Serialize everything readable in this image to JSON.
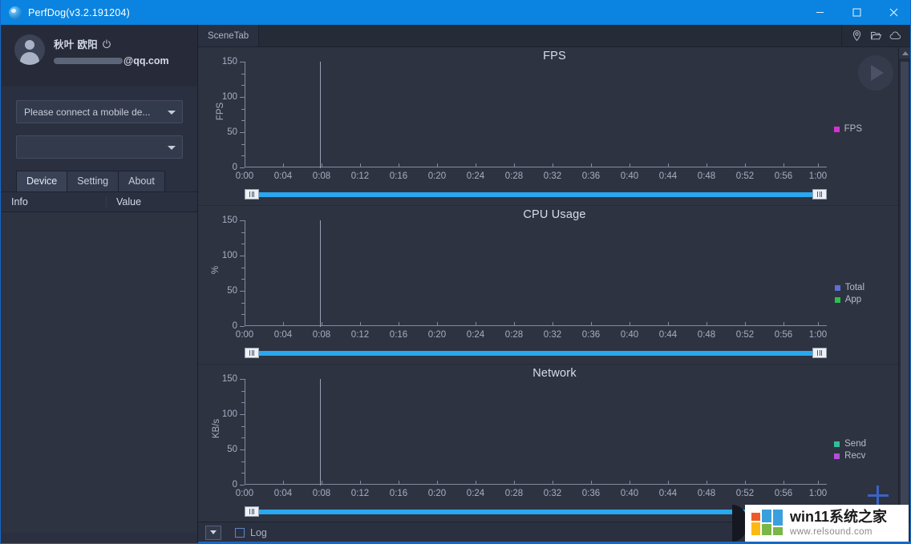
{
  "window": {
    "title": "PerfDog(v3.2.191204)",
    "logo_icon": "perfdog-logo-icon",
    "minimize_label": "Minimize",
    "maximize_label": "Maximize",
    "close_label": "Close"
  },
  "sidebar": {
    "user": {
      "name": "秋叶 欧阳",
      "power_icon": "power-icon",
      "email": "@qq.com",
      "avatar_icon": "user-avatar-icon"
    },
    "device_select": {
      "value": "Please connect a mobile de...",
      "caret_icon": "chevron-down-icon"
    },
    "app_select": {
      "value": "",
      "placeholder": "",
      "caret_icon": "chevron-down-icon"
    },
    "tabs": [
      {
        "label": "Device",
        "active": true
      },
      {
        "label": "Setting",
        "active": false
      },
      {
        "label": "About",
        "active": false
      }
    ],
    "table": {
      "columns": [
        "Info",
        "Value"
      ],
      "rows": []
    }
  },
  "scenebar": {
    "tab_label": "SceneTab",
    "icons": [
      {
        "name": "location-pin-icon",
        "label": "Location"
      },
      {
        "name": "open-folder-icon",
        "label": "Open folder"
      },
      {
        "name": "cloud-icon",
        "label": "Cloud"
      }
    ]
  },
  "controls": {
    "play_label": "Start",
    "play_icon": "play-icon",
    "add_label": "Add",
    "add_icon": "plus-icon",
    "collapse_icon": "chevron-down-icon",
    "log_label": "Log",
    "log_checked": false,
    "slider_handle_icon": "slider-grip-icon"
  },
  "axis": {
    "y_ticks": [
      "150",
      "100",
      "50",
      "0"
    ],
    "x_ticks": [
      "0:00",
      "0:04",
      "0:08",
      "0:12",
      "0:16",
      "0:20",
      "0:24",
      "0:28",
      "0:32",
      "0:36",
      "0:40",
      "0:44",
      "0:48",
      "0:52",
      "0:56",
      "1:00"
    ]
  },
  "chart_data": [
    {
      "type": "line",
      "title": "FPS",
      "xlabel": "",
      "ylabel": "FPS",
      "ylim": [
        0,
        150
      ],
      "y_ticks": [
        0,
        50,
        100,
        150
      ],
      "x_ticks": [
        "0:00",
        "0:04",
        "0:08",
        "0:12",
        "0:16",
        "0:20",
        "0:24",
        "0:28",
        "0:32",
        "0:36",
        "0:40",
        "0:44",
        "0:48",
        "0:52",
        "0:56",
        "1:00"
      ],
      "grid": false,
      "legend_position": "right",
      "cursor_time": "0:07",
      "series": [
        {
          "name": "FPS",
          "color": "#d62fd6",
          "values": []
        }
      ]
    },
    {
      "type": "line",
      "title": "CPU Usage",
      "xlabel": "",
      "ylabel": "%",
      "ylim": [
        0,
        150
      ],
      "y_ticks": [
        0,
        50,
        100,
        150
      ],
      "x_ticks": [
        "0:00",
        "0:04",
        "0:08",
        "0:12",
        "0:16",
        "0:20",
        "0:24",
        "0:28",
        "0:32",
        "0:36",
        "0:40",
        "0:44",
        "0:48",
        "0:52",
        "0:56",
        "1:00"
      ],
      "grid": false,
      "legend_position": "right",
      "cursor_time": "0:07",
      "series": [
        {
          "name": "Total",
          "color": "#5d6fd8",
          "values": []
        },
        {
          "name": "App",
          "color": "#2fbf4f",
          "values": []
        }
      ]
    },
    {
      "type": "line",
      "title": "Network",
      "xlabel": "",
      "ylabel": "KB/s",
      "ylim": [
        0,
        150
      ],
      "y_ticks": [
        0,
        50,
        100,
        150
      ],
      "x_ticks": [
        "0:00",
        "0:04",
        "0:08",
        "0:12",
        "0:16",
        "0:20",
        "0:24",
        "0:28",
        "0:32",
        "0:36",
        "0:40",
        "0:44",
        "0:48",
        "0:52",
        "0:56",
        "1:00"
      ],
      "grid": false,
      "legend_position": "right",
      "cursor_time": "0:07",
      "series": [
        {
          "name": "Send",
          "color": "#2fbf9a",
          "values": []
        },
        {
          "name": "Recv",
          "color": "#b24fd8",
          "values": []
        }
      ]
    }
  ],
  "watermark": {
    "title": "win11系统之家",
    "url": "www.relsound.com"
  },
  "colors": {
    "accent": "#0a84e0",
    "slider": "#29a8f0",
    "panel": "#2e3342",
    "sidebar": "#2b3040"
  }
}
